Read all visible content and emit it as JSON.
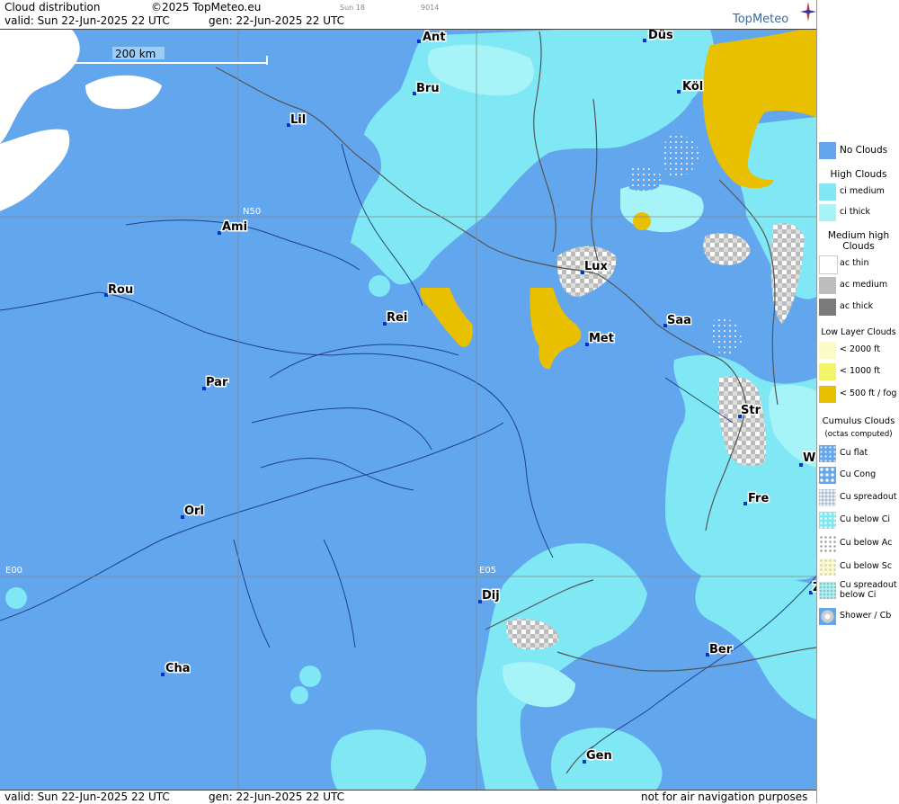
{
  "header": {
    "title": "Cloud distribution",
    "copyright": "©2025 TopMeteo.eu",
    "valid": "valid:  Sun  22-Jun-2025  22 UTC",
    "generated": "gen: 22-Jun-2025 22 UTC",
    "small_a": "Sun 18",
    "small_b": "9014",
    "logo": "TopMeteo"
  },
  "footer": {
    "valid": "valid:  Sun  22-Jun-2025  22 UTC",
    "generated": "gen: 22-Jun-2025 22 UTC",
    "disclaimer": "not for air navigation purposes"
  },
  "map": {
    "scale_label": "200 km",
    "grid_labels": [
      "N50",
      "E00",
      "E05"
    ],
    "cities": [
      {
        "name": "Ant"
      },
      {
        "name": "Düs"
      },
      {
        "name": "Bru"
      },
      {
        "name": "Köl"
      },
      {
        "name": "Lil"
      },
      {
        "name": "Ami"
      },
      {
        "name": "Lux"
      },
      {
        "name": "Rou"
      },
      {
        "name": "Rei"
      },
      {
        "name": "Met"
      },
      {
        "name": "Saa"
      },
      {
        "name": "Par"
      },
      {
        "name": "Str"
      },
      {
        "name": "W"
      },
      {
        "name": "Orl"
      },
      {
        "name": "Fre"
      },
      {
        "name": "Dij"
      },
      {
        "name": "Z"
      },
      {
        "name": "Ber"
      },
      {
        "name": "Cha"
      },
      {
        "name": "Gen"
      }
    ]
  },
  "colors": {
    "no_clouds": "#62a6ee",
    "ci_medium": "#7fe8f4",
    "ci_thick": "#a6f4f8",
    "low_500": "#e8c000",
    "white": "#ffffff"
  },
  "legend": {
    "no_clouds": "No Clouds",
    "high_title": "High Clouds",
    "ci_medium": "ci medium",
    "ci_thick": "ci thick",
    "medium_title": "Medium high Clouds",
    "ac_thin": "ac thin",
    "ac_medium": "ac medium",
    "ac_thick": "ac thick",
    "low_title": "Low Layer Clouds",
    "low_2000": "< 2000 ft",
    "low_1000": "< 1000 ft",
    "low_500": "< 500 ft / fog",
    "cu_title": "Cumulus Clouds",
    "cu_sub": "(octas computed)",
    "cu_flat": "Cu flat",
    "cu_cong": "Cu Cong",
    "cu_spread": "Cu spreadout",
    "cu_below_ci": "Cu below Ci",
    "cu_below_ac": "Cu below Ac",
    "cu_below_sc": "Cu below Sc",
    "cu_spread_ci_a": "Cu spreadout",
    "cu_spread_ci_b": "below Ci",
    "shower": "Shower / Cb"
  }
}
